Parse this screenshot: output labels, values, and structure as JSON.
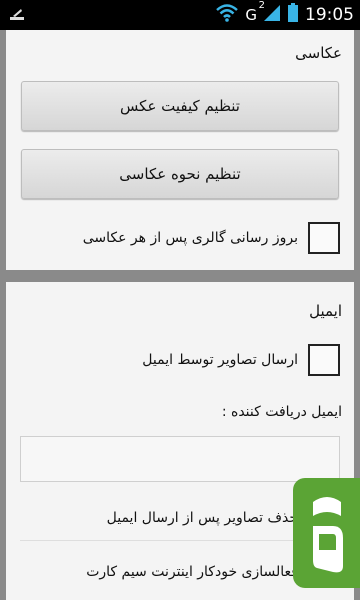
{
  "statusbar": {
    "network": "G",
    "network_sup": "2",
    "time": "19:05"
  },
  "photography": {
    "title": "عکاسی",
    "btn_quality": "تنظیم کیفیت عکس",
    "btn_method": "تنظیم نحوه عکاسی",
    "refresh_gallery": "بروز رسانی گالری پس از هر عکاسی"
  },
  "email": {
    "title": "ایمیل",
    "send_photos": "ارسال تصاویر توسط ایمیل",
    "recipient_label": "ایمیل دریافت کننده :",
    "recipient_value": "",
    "delete_after_send": "حذف تصاویر پس از ارسال ایمیل",
    "auto_sim_internet": "فعالسازی خودکار اینترنت سیم کارت"
  },
  "colors": {
    "badge": "#5ba435",
    "card": "#f4f4f4",
    "background": "#8a8a8a"
  }
}
